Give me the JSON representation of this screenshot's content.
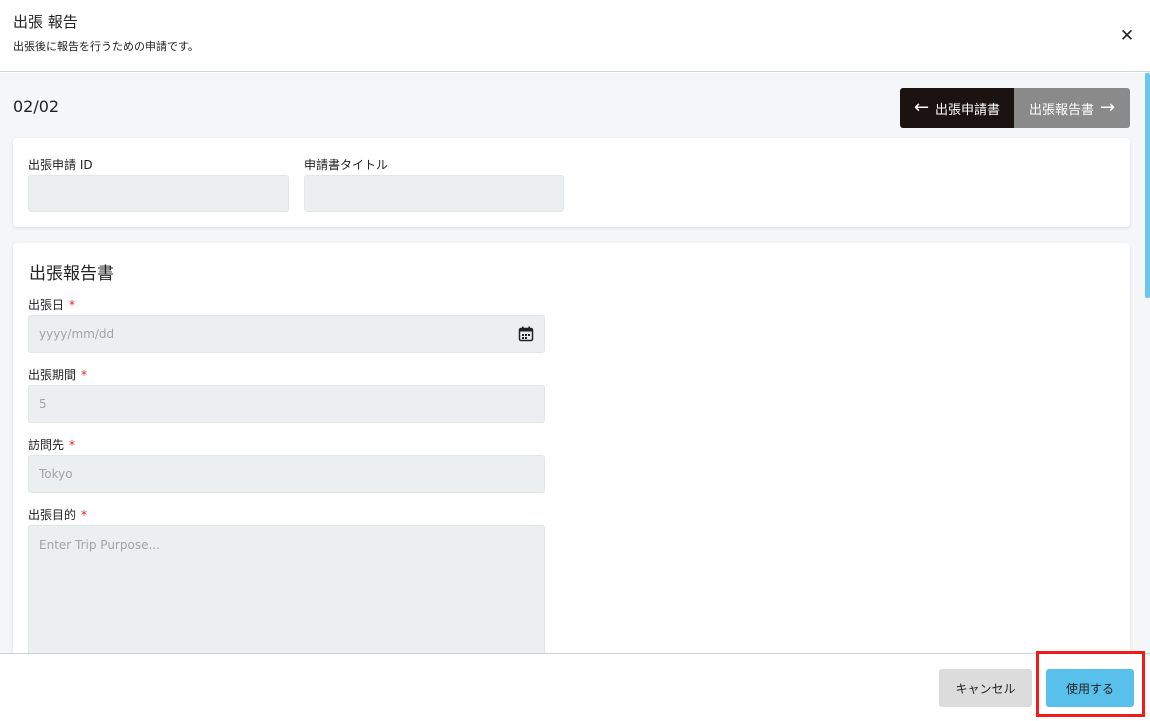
{
  "modal": {
    "title": "出張 報告",
    "subtitle": "出張後に報告を行うための申請です。",
    "close_icon": "close-icon"
  },
  "navigation": {
    "page_counter": "02/02",
    "prev_label": "出張申請書",
    "next_label": "出張報告書",
    "prev_arrow": "←",
    "next_arrow": "→"
  },
  "ids_card": {
    "application_id_label": "出張申請 ID",
    "application_id_value": "",
    "title_label": "申請書タイトル",
    "title_value": ""
  },
  "report": {
    "section_title": "出張報告書",
    "required_mark": "*",
    "trip_date": {
      "label": "出張日",
      "placeholder": "yyyy/mm/dd"
    },
    "trip_period": {
      "label": "出張期間",
      "value": "5"
    },
    "destination": {
      "label": "訪問先",
      "value": "Tokyo"
    },
    "purpose": {
      "label": "出張目的",
      "placeholder": "Enter Trip Purpose..."
    }
  },
  "footer": {
    "cancel_label": "キャンセル",
    "use_label": "使用する"
  },
  "colors": {
    "accent": "#59c0ec",
    "nav_active": "#1b1212",
    "nav_inactive": "#8a8a8a",
    "required": "#e0242b",
    "highlight": "#f21a1a"
  }
}
